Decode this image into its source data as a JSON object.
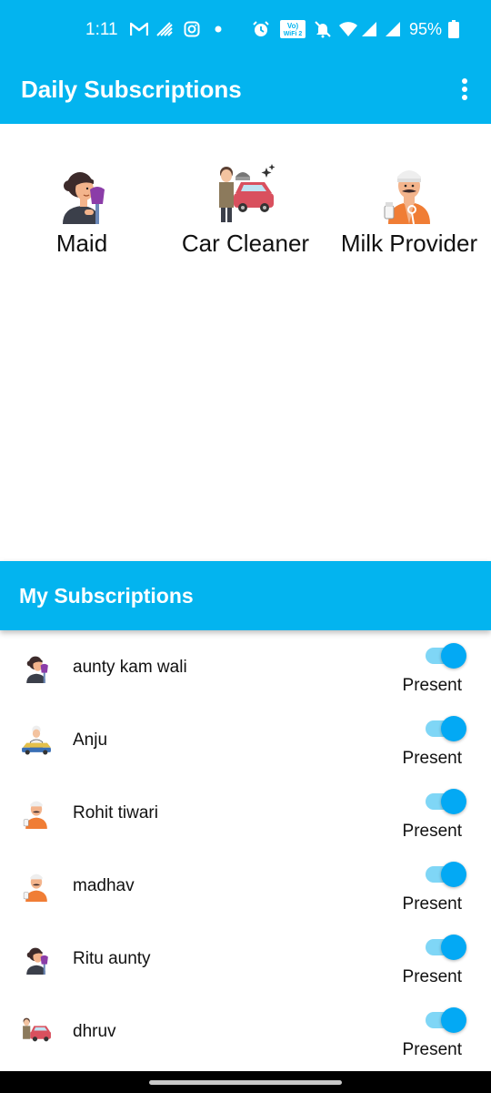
{
  "status_bar": {
    "time": "1:11",
    "battery_percent": "95%",
    "icons": [
      "gmail-icon",
      "wireless-icon",
      "instagram-icon",
      "dot-icon",
      "alarm-icon",
      "vowifi-icon",
      "mute-icon",
      "wifi-icon",
      "signal-icon",
      "signal-icon",
      "battery-icon"
    ],
    "vowifi_label": "Vo) WiFi 2"
  },
  "app_bar": {
    "title": "Daily Subscriptions"
  },
  "categories": [
    {
      "label": "Maid",
      "icon": "maid-icon"
    },
    {
      "label": "Car Cleaner",
      "icon": "car-cleaner-icon"
    },
    {
      "label": "Milk Provider",
      "icon": "milk-provider-icon"
    }
  ],
  "subscriptions_section": {
    "title": "My Subscriptions"
  },
  "subscriptions": [
    {
      "name": "aunty kam wali",
      "icon": "maid-icon",
      "status": "Present",
      "enabled": true
    },
    {
      "name": "Anju",
      "icon": "car-cleaner-icon",
      "status": "Present",
      "enabled": true
    },
    {
      "name": "Rohit tiwari",
      "icon": "milk-provider-icon",
      "status": "Present",
      "enabled": true
    },
    {
      "name": "madhav",
      "icon": "milk-provider-icon",
      "status": "Present",
      "enabled": true
    },
    {
      "name": "Ritu aunty",
      "icon": "maid-icon",
      "status": "Present",
      "enabled": true
    },
    {
      "name": "dhruv",
      "icon": "car-cleaner-icon",
      "status": "Present",
      "enabled": true
    }
  ],
  "colors": {
    "primary": "#03b4ef",
    "toggle_thumb": "#03a9f4",
    "toggle_track": "#7fd6f6"
  }
}
